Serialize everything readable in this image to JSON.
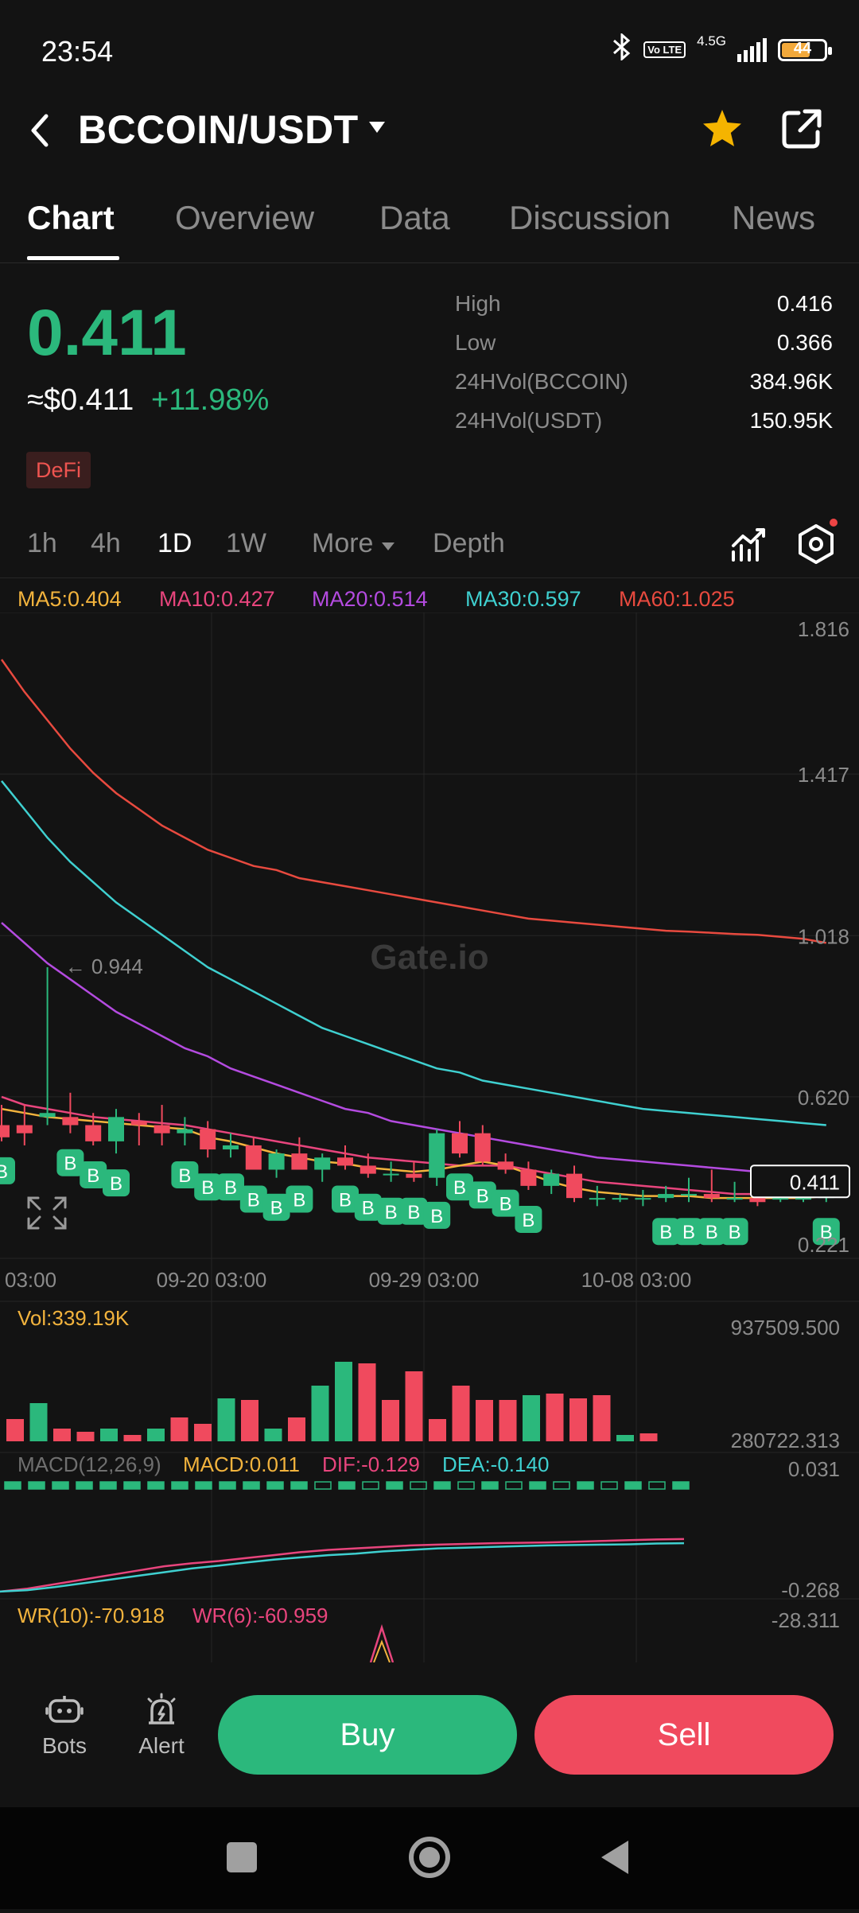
{
  "status_bar": {
    "time": "23:54",
    "network": "4.5G",
    "lte": "Vo LTE",
    "battery": "44"
  },
  "header": {
    "pair": "BCCOIN/USDT"
  },
  "tabs": [
    {
      "label": "Chart",
      "active": true
    },
    {
      "label": "Overview",
      "active": false
    },
    {
      "label": "Data",
      "active": false
    },
    {
      "label": "Discussion",
      "active": false
    },
    {
      "label": "News",
      "active": false
    }
  ],
  "ticker": {
    "price": "0.411",
    "fiat": "≈$0.411",
    "change": "+11.98%",
    "tag": "DeFi",
    "stats": [
      {
        "label": "High",
        "value": "0.416"
      },
      {
        "label": "Low",
        "value": "0.366"
      },
      {
        "label": "24HVol(BCCOIN)",
        "value": "384.96K"
      },
      {
        "label": "24HVol(USDT)",
        "value": "150.95K"
      }
    ]
  },
  "timeframes": {
    "items": [
      "1h",
      "4h",
      "1D",
      "1W",
      "More",
      "Depth"
    ],
    "active": "1D"
  },
  "ma_legend": [
    {
      "label": "MA5:0.404",
      "color": "#f2b33d"
    },
    {
      "label": "MA10:0.427",
      "color": "#e8457d"
    },
    {
      "label": "MA20:0.514",
      "color": "#b44be0"
    },
    {
      "label": "MA30:0.597",
      "color": "#3fd0d0"
    },
    {
      "label": "MA60:1.025",
      "color": "#e84a3f"
    }
  ],
  "chart_data": {
    "type": "candlestick",
    "watermark": "Gate.io",
    "price_axis": [
      "1.816",
      "1.417",
      "1.018",
      "0.620",
      "0.221"
    ],
    "current_price_label": "0.411",
    "max_marker": "← 0.944",
    "x_labels": [
      "03:00",
      "09-20 03:00",
      "09-29 03:00",
      "10-08 03:00"
    ],
    "candles": [
      {
        "o": 0.55,
        "h": 0.6,
        "l": 0.51,
        "c": 0.52
      },
      {
        "o": 0.55,
        "h": 0.6,
        "l": 0.5,
        "c": 0.53
      },
      {
        "o": 0.57,
        "h": 0.94,
        "l": 0.55,
        "c": 0.58
      },
      {
        "o": 0.57,
        "h": 0.63,
        "l": 0.53,
        "c": 0.55
      },
      {
        "o": 0.55,
        "h": 0.58,
        "l": 0.5,
        "c": 0.51
      },
      {
        "o": 0.51,
        "h": 0.59,
        "l": 0.48,
        "c": 0.57
      },
      {
        "o": 0.56,
        "h": 0.58,
        "l": 0.5,
        "c": 0.55
      },
      {
        "o": 0.55,
        "h": 0.6,
        "l": 0.5,
        "c": 0.53
      },
      {
        "o": 0.53,
        "h": 0.57,
        "l": 0.5,
        "c": 0.54
      },
      {
        "o": 0.54,
        "h": 0.56,
        "l": 0.47,
        "c": 0.49
      },
      {
        "o": 0.49,
        "h": 0.53,
        "l": 0.47,
        "c": 0.5
      },
      {
        "o": 0.5,
        "h": 0.52,
        "l": 0.44,
        "c": 0.44
      },
      {
        "o": 0.44,
        "h": 0.49,
        "l": 0.42,
        "c": 0.48
      },
      {
        "o": 0.48,
        "h": 0.52,
        "l": 0.44,
        "c": 0.44
      },
      {
        "o": 0.44,
        "h": 0.48,
        "l": 0.41,
        "c": 0.47
      },
      {
        "o": 0.47,
        "h": 0.5,
        "l": 0.44,
        "c": 0.45
      },
      {
        "o": 0.45,
        "h": 0.48,
        "l": 0.42,
        "c": 0.43
      },
      {
        "o": 0.43,
        "h": 0.46,
        "l": 0.41,
        "c": 0.43
      },
      {
        "o": 0.43,
        "h": 0.46,
        "l": 0.41,
        "c": 0.42
      },
      {
        "o": 0.42,
        "h": 0.54,
        "l": 0.4,
        "c": 0.53
      },
      {
        "o": 0.53,
        "h": 0.56,
        "l": 0.47,
        "c": 0.48
      },
      {
        "o": 0.53,
        "h": 0.55,
        "l": 0.45,
        "c": 0.46
      },
      {
        "o": 0.46,
        "h": 0.48,
        "l": 0.43,
        "c": 0.44
      },
      {
        "o": 0.44,
        "h": 0.46,
        "l": 0.39,
        "c": 0.4
      },
      {
        "o": 0.4,
        "h": 0.44,
        "l": 0.38,
        "c": 0.43
      },
      {
        "o": 0.43,
        "h": 0.45,
        "l": 0.36,
        "c": 0.37
      },
      {
        "o": 0.37,
        "h": 0.4,
        "l": 0.35,
        "c": 0.37
      },
      {
        "o": 0.37,
        "h": 0.38,
        "l": 0.36,
        "c": 0.37
      },
      {
        "o": 0.37,
        "h": 0.39,
        "l": 0.35,
        "c": 0.37
      },
      {
        "o": 0.37,
        "h": 0.4,
        "l": 0.36,
        "c": 0.38
      },
      {
        "o": 0.38,
        "h": 0.42,
        "l": 0.36,
        "c": 0.38
      },
      {
        "o": 0.38,
        "h": 0.44,
        "l": 0.36,
        "c": 0.37
      },
      {
        "o": 0.37,
        "h": 0.41,
        "l": 0.36,
        "c": 0.37
      },
      {
        "o": 0.37,
        "h": 0.39,
        "l": 0.35,
        "c": 0.36
      },
      {
        "o": 0.37,
        "h": 0.38,
        "l": 0.36,
        "c": 0.37
      },
      {
        "o": 0.37,
        "h": 0.4,
        "l": 0.36,
        "c": 0.37
      },
      {
        "o": 0.37,
        "h": 0.41,
        "l": 0.36,
        "c": 0.41
      }
    ],
    "buy_markers": [
      0,
      3,
      4,
      5,
      8,
      9,
      10,
      11,
      12,
      13,
      15,
      16,
      17,
      18,
      19,
      20,
      21,
      22,
      23,
      29,
      30,
      31,
      32,
      36
    ],
    "ma_lines": {
      "MA60": [
        1.7,
        1.62,
        1.55,
        1.48,
        1.42,
        1.37,
        1.33,
        1.29,
        1.26,
        1.23,
        1.21,
        1.19,
        1.18,
        1.16,
        1.15,
        1.14,
        1.13,
        1.12,
        1.11,
        1.1,
        1.09,
        1.08,
        1.07,
        1.06,
        1.055,
        1.05,
        1.045,
        1.04,
        1.035,
        1.03,
        1.028,
        1.025,
        1.022,
        1.02,
        1.015,
        1.01,
        1.0
      ],
      "MA30": [
        1.4,
        1.33,
        1.26,
        1.2,
        1.15,
        1.1,
        1.06,
        1.02,
        0.98,
        0.94,
        0.91,
        0.88,
        0.85,
        0.82,
        0.79,
        0.77,
        0.75,
        0.73,
        0.71,
        0.69,
        0.68,
        0.66,
        0.65,
        0.64,
        0.63,
        0.62,
        0.61,
        0.6,
        0.59,
        0.585,
        0.58,
        0.575,
        0.57,
        0.565,
        0.56,
        0.555,
        0.55
      ],
      "MA20": [
        1.05,
        1.0,
        0.95,
        0.91,
        0.87,
        0.83,
        0.8,
        0.77,
        0.74,
        0.72,
        0.69,
        0.67,
        0.65,
        0.63,
        0.61,
        0.59,
        0.58,
        0.56,
        0.55,
        0.54,
        0.53,
        0.52,
        0.51,
        0.5,
        0.49,
        0.48,
        0.47,
        0.465,
        0.46,
        0.455,
        0.45,
        0.445,
        0.44,
        0.435,
        0.43,
        0.42,
        0.41
      ],
      "MA10": [
        0.62,
        0.6,
        0.59,
        0.58,
        0.57,
        0.565,
        0.56,
        0.555,
        0.55,
        0.54,
        0.53,
        0.52,
        0.51,
        0.5,
        0.49,
        0.48,
        0.47,
        0.465,
        0.46,
        0.455,
        0.45,
        0.45,
        0.45,
        0.44,
        0.43,
        0.42,
        0.41,
        0.405,
        0.4,
        0.395,
        0.39,
        0.385,
        0.38,
        0.38,
        0.38,
        0.375,
        0.375
      ],
      "MA5": [
        0.59,
        0.58,
        0.57,
        0.565,
        0.56,
        0.555,
        0.55,
        0.545,
        0.54,
        0.52,
        0.51,
        0.495,
        0.48,
        0.47,
        0.46,
        0.455,
        0.445,
        0.44,
        0.435,
        0.44,
        0.45,
        0.46,
        0.45,
        0.43,
        0.41,
        0.395,
        0.385,
        0.38,
        0.375,
        0.375,
        0.375,
        0.37,
        0.37,
        0.37,
        0.37,
        0.37,
        0.375
      ]
    },
    "volume": {
      "label": "Vol:339.19K",
      "axis": [
        "937509.500",
        "280722.313"
      ],
      "bars": [
        0.28,
        0.48,
        0.16,
        0.12,
        0.16,
        0.08,
        0.16,
        0.3,
        0.22,
        0.54,
        0.52,
        0.16,
        0.3,
        0.7,
        1.0,
        0.98,
        0.52,
        0.88,
        0.28,
        0.7,
        0.52,
        0.52,
        0.58,
        0.6,
        0.54,
        0.58,
        0.06,
        0.1
      ]
    },
    "macd": {
      "label": "MACD(12,26,9)",
      "macd": "MACD:0.011",
      "dif": "DIF:-0.129",
      "dea": "DEA:-0.140",
      "axis": [
        "0.031",
        "-0.268"
      ],
      "dif_line": [
        -0.27,
        -0.262,
        -0.25,
        -0.238,
        -0.226,
        -0.214,
        -0.202,
        -0.194,
        -0.188,
        -0.18,
        -0.172,
        -0.164,
        -0.158,
        -0.154,
        -0.15,
        -0.146,
        -0.144,
        -0.142,
        -0.14,
        -0.139,
        -0.138,
        -0.136,
        -0.134,
        -0.132,
        -0.13,
        -0.129
      ],
      "dea_line": [
        -0.27,
        -0.266,
        -0.258,
        -0.248,
        -0.238,
        -0.228,
        -0.218,
        -0.208,
        -0.2,
        -0.192,
        -0.184,
        -0.178,
        -0.172,
        -0.168,
        -0.162,
        -0.158,
        -0.154,
        -0.152,
        -0.15,
        -0.148,
        -0.146,
        -0.145,
        -0.144,
        -0.143,
        -0.141,
        -0.14
      ]
    },
    "wr": {
      "wr10": "WR(10):-70.918",
      "wr6": "WR(6):-60.959",
      "axis": "-28.311"
    }
  },
  "bottom": {
    "bots": "Bots",
    "alert": "Alert",
    "buy": "Buy",
    "sell": "Sell"
  },
  "colors": {
    "up": "#2bb87c",
    "down": "#f04a5e",
    "bg": "#131313"
  }
}
